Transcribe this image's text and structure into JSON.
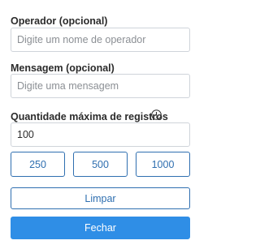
{
  "operator": {
    "label": "Operador (opcional)",
    "placeholder": "Digite um nome de operador",
    "value": ""
  },
  "message": {
    "label": "Mensagem (opcional)",
    "placeholder": "Digite uma mensagem",
    "value": ""
  },
  "max_records": {
    "label": "Quantidade máxima de registros",
    "info_icon": "info-circle-icon",
    "value": "100",
    "presets": [
      "250",
      "500",
      "1000"
    ]
  },
  "actions": {
    "clear_label": "Limpar",
    "close_label": "Fechar"
  },
  "colors": {
    "accent": "#2f6fb0",
    "primary_button": "#2f8ee6",
    "text": "#2b2b2b",
    "border": "#cfd4da"
  }
}
